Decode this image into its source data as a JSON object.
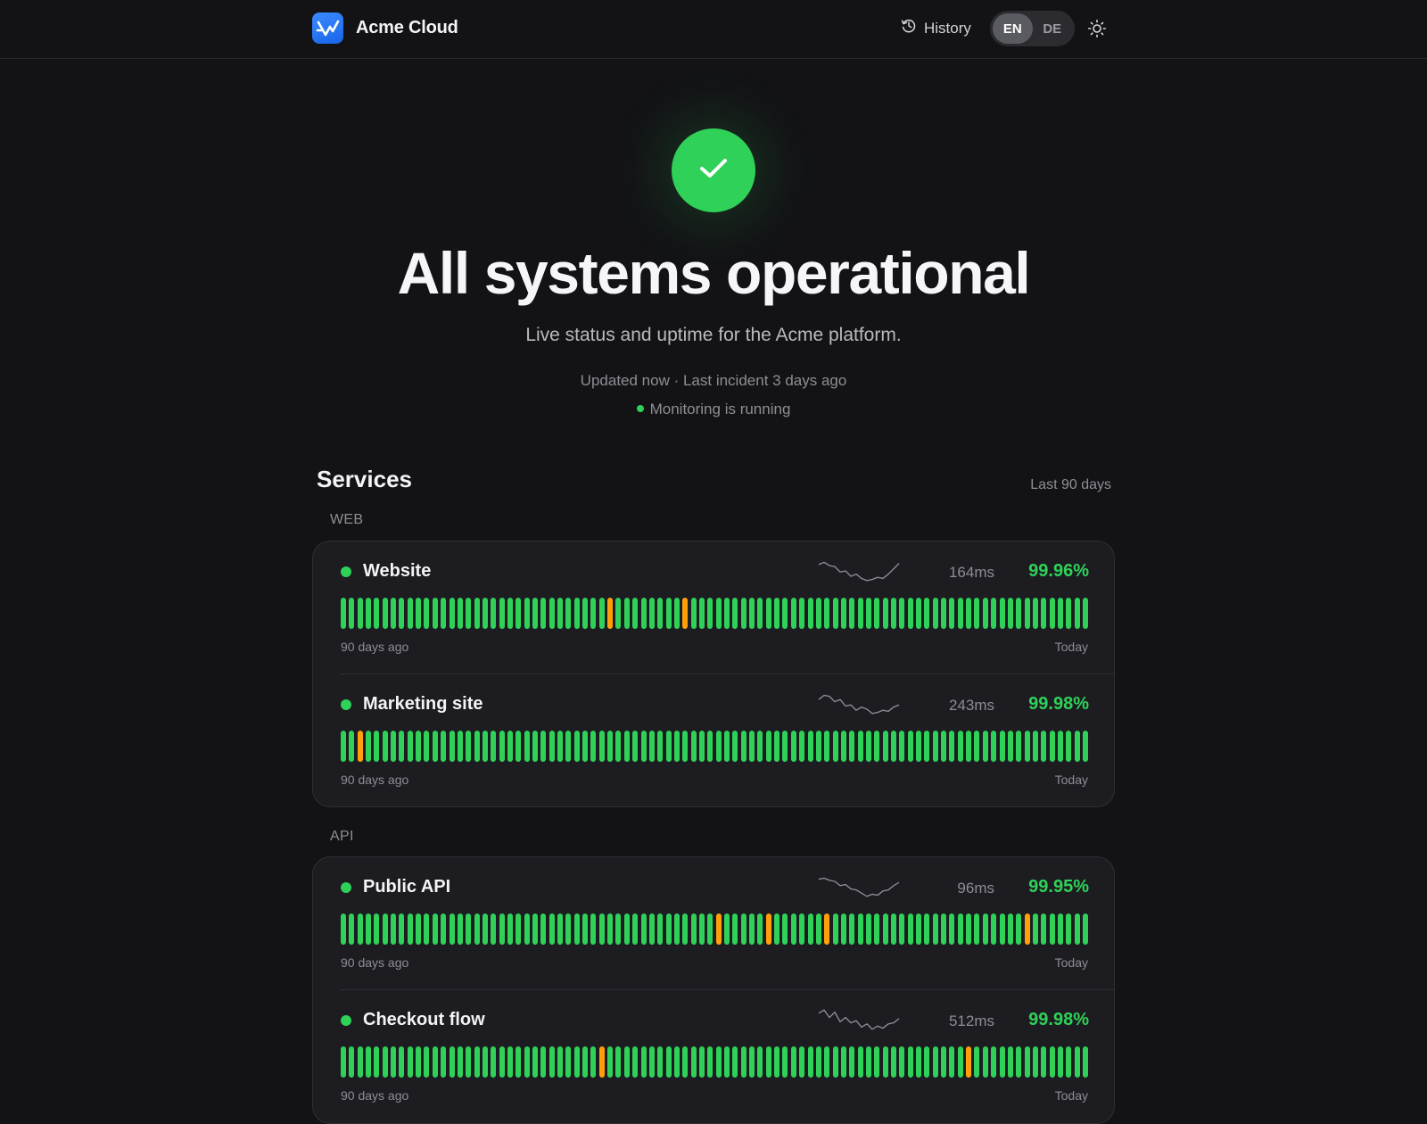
{
  "header": {
    "brand": "Acme Cloud",
    "logo_icon": "status-logo-icon",
    "history_label": "History",
    "history_icon": "history-icon",
    "languages": [
      {
        "code": "EN",
        "active": true
      },
      {
        "code": "DE",
        "active": false
      }
    ],
    "theme_icon": "sun-icon"
  },
  "hero": {
    "icon": "check-icon",
    "title": "All systems operational",
    "subtitle": "Live status and uptime for the Acme platform.",
    "meta": "Updated now · Last incident 3 days ago",
    "monitoring": "Monitoring is running"
  },
  "services": {
    "title": "Services",
    "range": "Last 90 days",
    "colors": {
      "operational": "#2fd158",
      "degraded": "#ff9f0a",
      "accent": "#1a73ff"
    },
    "groups": [
      {
        "label": "WEB",
        "items": [
          {
            "name": "Website",
            "latency": "164ms",
            "uptime": "99.96%",
            "status": "operational",
            "degraded_days": [
              32,
              41
            ],
            "sparkline": [
              0.8,
              0.9,
              0.75,
              0.7,
              0.45,
              0.5,
              0.25,
              0.35,
              0.15,
              0.05,
              0.1,
              0.2,
              0.15,
              0.35,
              0.6,
              0.85
            ]
          },
          {
            "name": "Marketing site",
            "latency": "243ms",
            "uptime": "99.98%",
            "status": "operational",
            "degraded_days": [
              2
            ],
            "sparkline": [
              0.7,
              0.9,
              0.85,
              0.6,
              0.7,
              0.4,
              0.45,
              0.2,
              0.35,
              0.25,
              0.05,
              0.1,
              0.2,
              0.15,
              0.35,
              0.45
            ]
          }
        ]
      },
      {
        "label": "API",
        "items": [
          {
            "name": "Public API",
            "latency": "96ms",
            "uptime": "99.95%",
            "status": "operational",
            "degraded_days": [
              45,
              51,
              58,
              82
            ],
            "sparkline": [
              0.85,
              0.9,
              0.8,
              0.75,
              0.55,
              0.6,
              0.4,
              0.35,
              0.2,
              0.05,
              0.15,
              0.1,
              0.3,
              0.35,
              0.55,
              0.7
            ]
          },
          {
            "name": "Checkout flow",
            "latency": "512ms",
            "uptime": "99.98%",
            "status": "operational",
            "degraded_days": [
              31,
              75
            ],
            "sparkline": [
              0.8,
              0.95,
              0.6,
              0.85,
              0.4,
              0.6,
              0.35,
              0.45,
              0.15,
              0.3,
              0.05,
              0.2,
              0.1,
              0.3,
              0.35,
              0.55
            ]
          }
        ]
      }
    ],
    "range_start_label": "90 days ago",
    "range_end_label": "Today"
  }
}
